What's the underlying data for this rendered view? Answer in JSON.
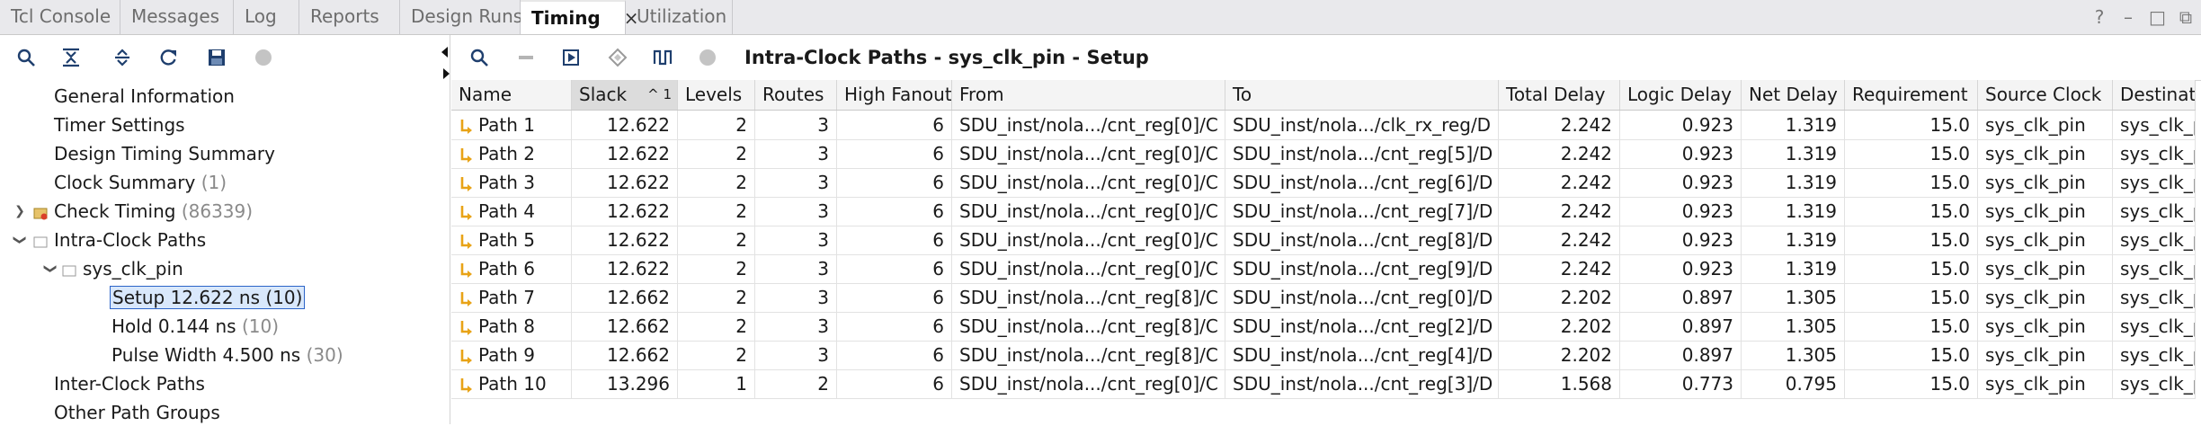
{
  "tabs": [
    {
      "label": "Tcl Console",
      "active": false
    },
    {
      "label": "Messages",
      "active": false
    },
    {
      "label": "Log",
      "active": false
    },
    {
      "label": "Reports",
      "active": false
    },
    {
      "label": "Design Runs",
      "active": false
    },
    {
      "label": "Timing",
      "active": true,
      "close": "×"
    },
    {
      "label": "Utilization",
      "active": false
    }
  ],
  "window_controls": {
    "help": "?",
    "minimize": "–",
    "restore": "□",
    "float": "⧉"
  },
  "tree": {
    "general_information": "General Information",
    "timer_settings": "Timer Settings",
    "design_timing_summary": "Design Timing Summary",
    "clock_summary": "Clock Summary",
    "clock_summary_count": "(1)",
    "check_timing": "Check Timing",
    "check_timing_count": "(86339)",
    "intra_clock_paths": "Intra-Clock Paths",
    "sys_clk_pin": "sys_clk_pin",
    "setup": "Setup 12.622 ns (10)",
    "hold": "Hold 0.144 ns",
    "hold_count": "(10)",
    "pulse_width": "Pulse Width 4.500 ns",
    "pulse_width_count": "(30)",
    "inter_clock_paths": "Inter-Clock Paths",
    "other_path_groups": "Other Path Groups"
  },
  "panel_title": "Intra-Clock Paths - sys_clk_pin - Setup",
  "columns": [
    "Name",
    "Slack",
    "Levels",
    "Routes",
    "High Fanout",
    "From",
    "To",
    "Total Delay",
    "Logic Delay",
    "Net Delay",
    "Requirement",
    "Source Clock",
    "Destination Clock"
  ],
  "sort_indicator": "^ 1",
  "rows": [
    [
      "Path 1",
      "12.622",
      "2",
      "3",
      "6",
      "SDU_inst/nola.../cnt_reg[0]/C",
      "SDU_inst/nola.../clk_rx_reg/D",
      "2.242",
      "0.923",
      "1.319",
      "15.0",
      "sys_clk_pin",
      "sys_clk_pin"
    ],
    [
      "Path 2",
      "12.622",
      "2",
      "3",
      "6",
      "SDU_inst/nola.../cnt_reg[0]/C",
      "SDU_inst/nola.../cnt_reg[5]/D",
      "2.242",
      "0.923",
      "1.319",
      "15.0",
      "sys_clk_pin",
      "sys_clk_pin"
    ],
    [
      "Path 3",
      "12.622",
      "2",
      "3",
      "6",
      "SDU_inst/nola.../cnt_reg[0]/C",
      "SDU_inst/nola.../cnt_reg[6]/D",
      "2.242",
      "0.923",
      "1.319",
      "15.0",
      "sys_clk_pin",
      "sys_clk_pin"
    ],
    [
      "Path 4",
      "12.622",
      "2",
      "3",
      "6",
      "SDU_inst/nola.../cnt_reg[0]/C",
      "SDU_inst/nola.../cnt_reg[7]/D",
      "2.242",
      "0.923",
      "1.319",
      "15.0",
      "sys_clk_pin",
      "sys_clk_pin"
    ],
    [
      "Path 5",
      "12.622",
      "2",
      "3",
      "6",
      "SDU_inst/nola.../cnt_reg[0]/C",
      "SDU_inst/nola.../cnt_reg[8]/D",
      "2.242",
      "0.923",
      "1.319",
      "15.0",
      "sys_clk_pin",
      "sys_clk_pin"
    ],
    [
      "Path 6",
      "12.622",
      "2",
      "3",
      "6",
      "SDU_inst/nola.../cnt_reg[0]/C",
      "SDU_inst/nola.../cnt_reg[9]/D",
      "2.242",
      "0.923",
      "1.319",
      "15.0",
      "sys_clk_pin",
      "sys_clk_pin"
    ],
    [
      "Path 7",
      "12.662",
      "2",
      "3",
      "6",
      "SDU_inst/nola.../cnt_reg[8]/C",
      "SDU_inst/nola.../cnt_reg[0]/D",
      "2.202",
      "0.897",
      "1.305",
      "15.0",
      "sys_clk_pin",
      "sys_clk_pin"
    ],
    [
      "Path 8",
      "12.662",
      "2",
      "3",
      "6",
      "SDU_inst/nola.../cnt_reg[8]/C",
      "SDU_inst/nola.../cnt_reg[2]/D",
      "2.202",
      "0.897",
      "1.305",
      "15.0",
      "sys_clk_pin",
      "sys_clk_pin"
    ],
    [
      "Path 9",
      "12.662",
      "2",
      "3",
      "6",
      "SDU_inst/nola.../cnt_reg[8]/C",
      "SDU_inst/nola.../cnt_reg[4]/D",
      "2.202",
      "0.897",
      "1.305",
      "15.0",
      "sys_clk_pin",
      "sys_clk_pin"
    ],
    [
      "Path 10",
      "13.296",
      "1",
      "2",
      "6",
      "SDU_inst/nola.../cnt_reg[0]/C",
      "SDU_inst/nola.../cnt_reg[3]/D",
      "1.568",
      "0.773",
      "0.795",
      "15.0",
      "sys_clk_pin",
      "sys_clk_pin"
    ]
  ],
  "colors": {
    "accent": "#2c64c8",
    "path_icon": "#e8a317",
    "save_icon": "#1f3f6e"
  }
}
